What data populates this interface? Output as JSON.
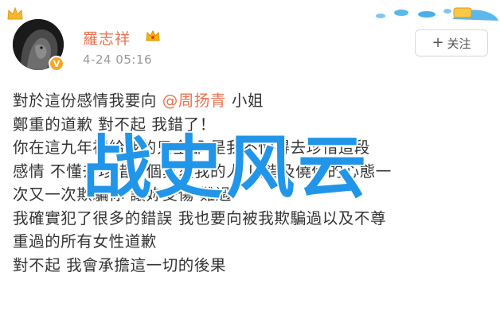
{
  "header": {
    "username": "羅志祥",
    "timestamp": "4-24 05:16",
    "follow_label": "关注",
    "icons": {
      "crown": "crown-icon",
      "vip": "vip-crown-icon",
      "verified": "verified-badge-icon",
      "plus": "plus-icon"
    }
  },
  "post": {
    "lines": [
      {
        "before": "對於這份感情我要向 ",
        "mention": "@周扬青",
        "after": " 小姐"
      },
      {
        "text": "鄭重的道歉 對不起 我錯了！"
      },
      {
        "text": "你在這九年裡給我的只全部 是我不懂得去珍惜這段"
      },
      {
        "text": "感情 不懂去珍惜一個真愛我的人 以錯及僥倖的心態一"
      },
      {
        "text": "次又一次欺騙你 讓妳受傷 難過"
      },
      {
        "text": "我確實犯了很多的錯誤 我也要向被我欺騙過以及不尊"
      },
      {
        "text": "重過的所有女性道歉"
      },
      {
        "text": "對不起   我會承擔這一切的後果"
      }
    ]
  },
  "watermark": {
    "text": "战史风云"
  },
  "colors": {
    "accent_orange": "#eb7350",
    "watermark_blue": "#2196e8",
    "timestamp_gray": "#9a9a9a"
  }
}
